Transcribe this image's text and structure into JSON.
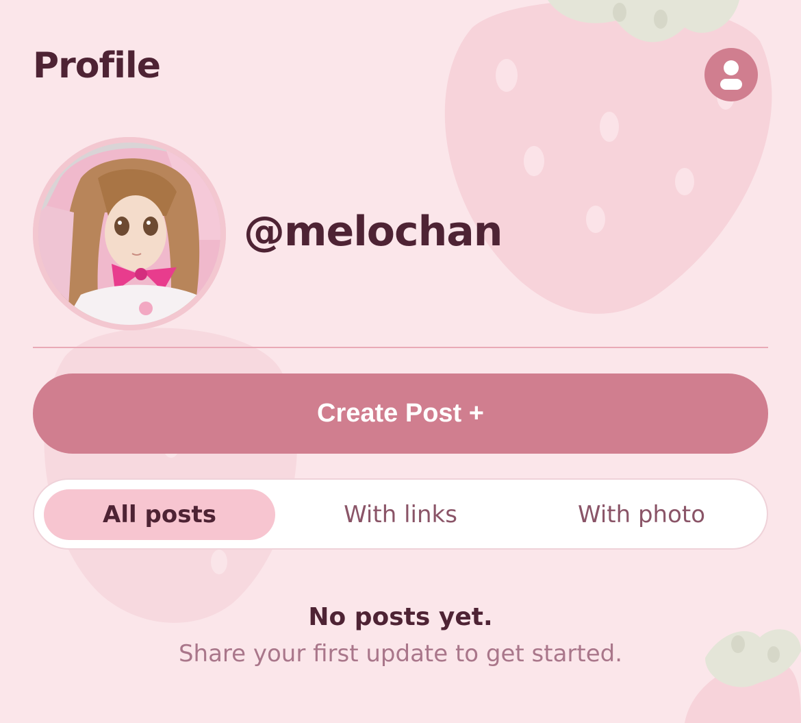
{
  "header": {
    "title": "Profile",
    "account_icon": "account-circle-icon"
  },
  "profile": {
    "username": "@melochan",
    "avatar_description": "avatar-photo"
  },
  "actions": {
    "create_post_label": "Create Post +"
  },
  "tabs": [
    {
      "label": "All posts",
      "selected": true
    },
    {
      "label": "With links",
      "selected": false
    },
    {
      "label": "With photo",
      "selected": false
    }
  ],
  "empty_state": {
    "title": "No posts yet.",
    "subtitle": "Share your first update to get started."
  },
  "colors": {
    "background": "#fbe6ea",
    "accent": "#d07e8f",
    "text_dark": "#4e2334",
    "text_muted": "#a9768a",
    "tab_selected": "#f7c5d0",
    "divider": "#e9a9b6"
  }
}
